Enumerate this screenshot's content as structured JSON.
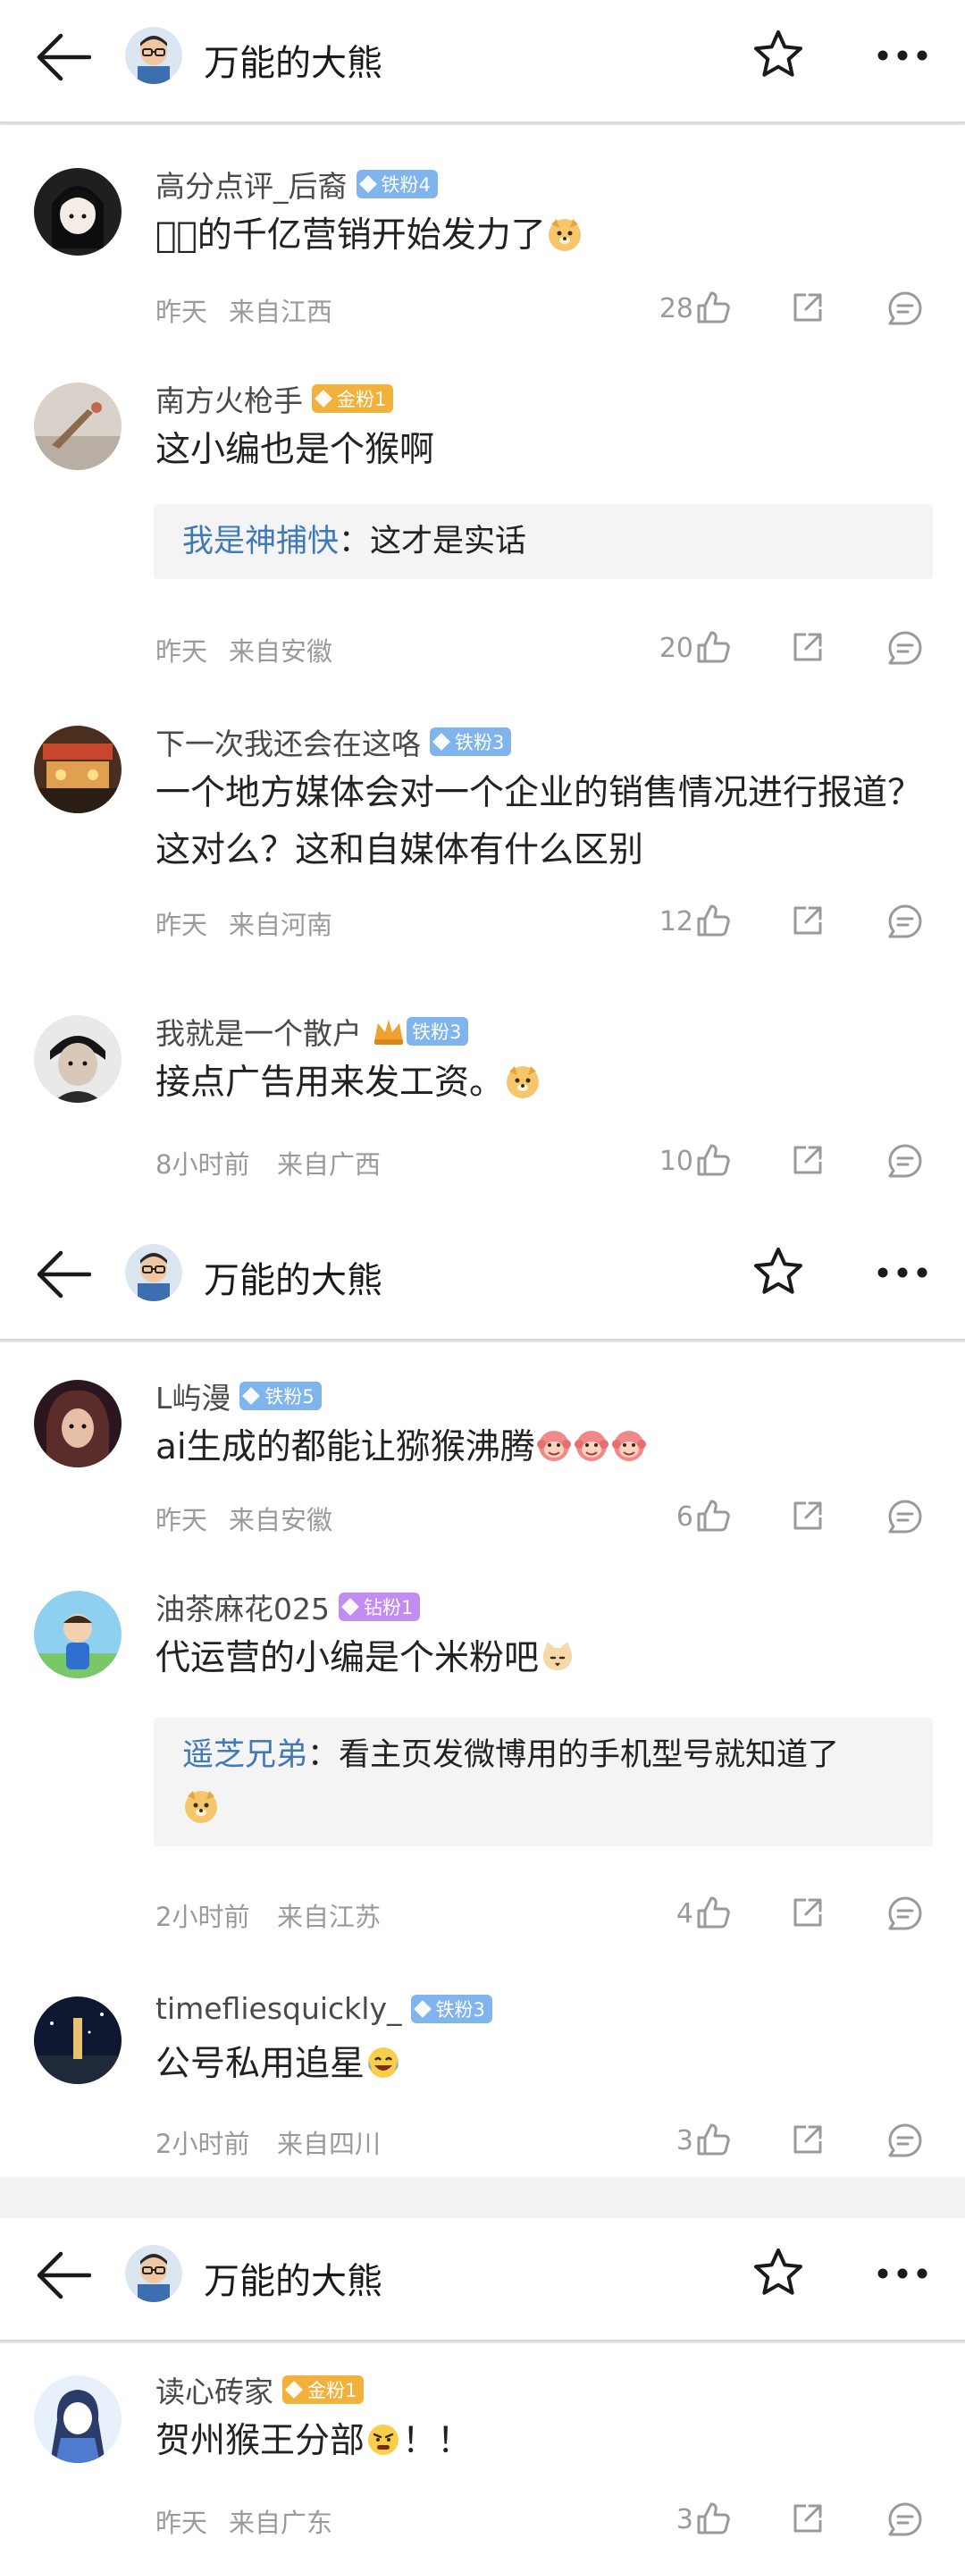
{
  "headers": [
    {
      "title": "万能的大熊"
    },
    {
      "title": "万能的大熊"
    },
    {
      "title": "万能的大熊"
    }
  ],
  "comments": [
    {
      "user": "高分点评_后裔",
      "badge": "铁粉4",
      "text": "我⃣的千亿营销开始发力了",
      "time": "昨天",
      "location": "来自江西",
      "likes": "28"
    },
    {
      "user": "南方火枪手",
      "badge": "金粉1",
      "text": "这小编也是个猴啊",
      "reply_user": "我是神捕快",
      "reply_text": "：这才是实话",
      "time": "昨天",
      "location": "来自安徽",
      "likes": "20"
    },
    {
      "user": "下一次我还会在这咯",
      "badge": "铁粉3",
      "text": "一个地方媒体会对一个企业的销售情况进行报道？这对么？这和自媒体有什么区别",
      "time": "昨天",
      "location": "来自河南",
      "likes": "12"
    },
    {
      "user": "我就是一个散户",
      "badge": "铁粉3",
      "text": "接点广告用来发工资。",
      "time": "8小时前",
      "location": "来自广西",
      "likes": "10"
    },
    {
      "user": "L屿漫",
      "badge": "铁粉5",
      "text": "ai生成的都能让猕猴沸腾",
      "time": "昨天",
      "location": "来自安徽",
      "likes": "6"
    },
    {
      "user": "油茶麻花025",
      "badge": "钻粉1",
      "text": "代运营的小编是个米粉吧",
      "reply_user": "遥芝兄弟",
      "reply_text": "：看主页发微博用的手机型号就知道了",
      "time": "2小时前",
      "location": "来自江苏",
      "likes": "4"
    },
    {
      "user": "timefliesquickly_",
      "badge": "铁粉3",
      "text": "公号私用追星",
      "time": "2小时前",
      "location": "来自四川",
      "likes": "3"
    },
    {
      "user": "读心砖家",
      "badge": "金粉1",
      "text": "贺州猴王分部",
      "text_tail": "！！",
      "time": "昨天",
      "location": "来自广东",
      "likes": "3"
    }
  ],
  "colors": {
    "iron_badge": "#7fb4ec",
    "gold_badge": "#f2b13b",
    "diamond_badge": "#c28cf0",
    "reply_name": "#3f79b8",
    "meta": "#9a9a9a"
  },
  "icons": [
    "back-arrow-icon",
    "star-icon",
    "more-icon",
    "like-icon",
    "share-icon",
    "comment-icon"
  ]
}
